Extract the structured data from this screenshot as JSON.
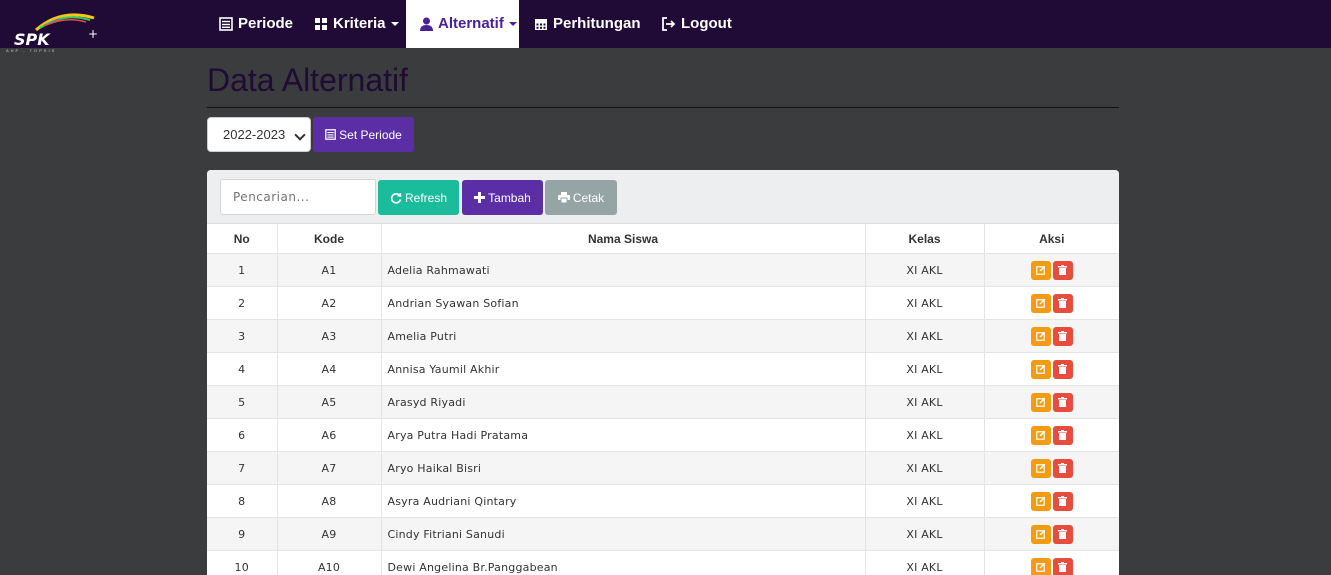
{
  "brand": {
    "name": "SPK",
    "tagline": "AHP - TOPSIS"
  },
  "nav": [
    {
      "label": "Periode",
      "icon": "list-icon",
      "dropdown": false,
      "active": false
    },
    {
      "label": "Kriteria",
      "icon": "grid-icon",
      "dropdown": true,
      "active": false
    },
    {
      "label": "Alternatif",
      "icon": "user-icon",
      "dropdown": true,
      "active": true
    },
    {
      "label": "Perhitungan",
      "icon": "calendar-icon",
      "dropdown": false,
      "active": false
    },
    {
      "label": "Logout",
      "icon": "logout-icon",
      "dropdown": false,
      "active": false
    }
  ],
  "page": {
    "title": "Data Alternatif",
    "period_value": "2022-2023",
    "set_period_label": "Set Periode"
  },
  "toolbar": {
    "search_placeholder": "Pencarian...",
    "refresh_label": "Refresh",
    "add_label": "Tambah",
    "print_label": "Cetak"
  },
  "table": {
    "headers": [
      "No",
      "Kode",
      "Nama Siswa",
      "Kelas",
      "Aksi"
    ],
    "rows": [
      {
        "no": "1",
        "kode": "A1",
        "nama": "Adelia Rahmawati",
        "kelas": "XI AKL"
      },
      {
        "no": "2",
        "kode": "A2",
        "nama": "Andrian Syawan Sofian",
        "kelas": "XI AKL"
      },
      {
        "no": "3",
        "kode": "A3",
        "nama": "Amelia Putri",
        "kelas": "XI AKL"
      },
      {
        "no": "4",
        "kode": "A4",
        "nama": "Annisa Yaumil Akhir",
        "kelas": "XI AKL"
      },
      {
        "no": "5",
        "kode": "A5",
        "nama": "Arasyd Riyadi",
        "kelas": "XI AKL"
      },
      {
        "no": "6",
        "kode": "A6",
        "nama": "Arya Putra Hadi Pratama",
        "kelas": "XI AKL"
      },
      {
        "no": "7",
        "kode": "A7",
        "nama": "Aryo Haikal Bisri",
        "kelas": "XI AKL"
      },
      {
        "no": "8",
        "kode": "A8",
        "nama": "Asyra Audriani Qintary",
        "kelas": "XI AKL"
      },
      {
        "no": "9",
        "kode": "A9",
        "nama": "Cindy Fitriani Sanudi",
        "kelas": "XI AKL"
      },
      {
        "no": "10",
        "kode": "A10",
        "nama": "Dewi Angelina Br.Panggabean",
        "kelas": "XI AKL"
      }
    ]
  },
  "colors": {
    "navbar": "#1f0b36",
    "primary": "#5b2ea5",
    "refresh": "#1abc9c",
    "print": "#95a5a6",
    "edit": "#f39c12",
    "delete": "#e74c3c"
  }
}
